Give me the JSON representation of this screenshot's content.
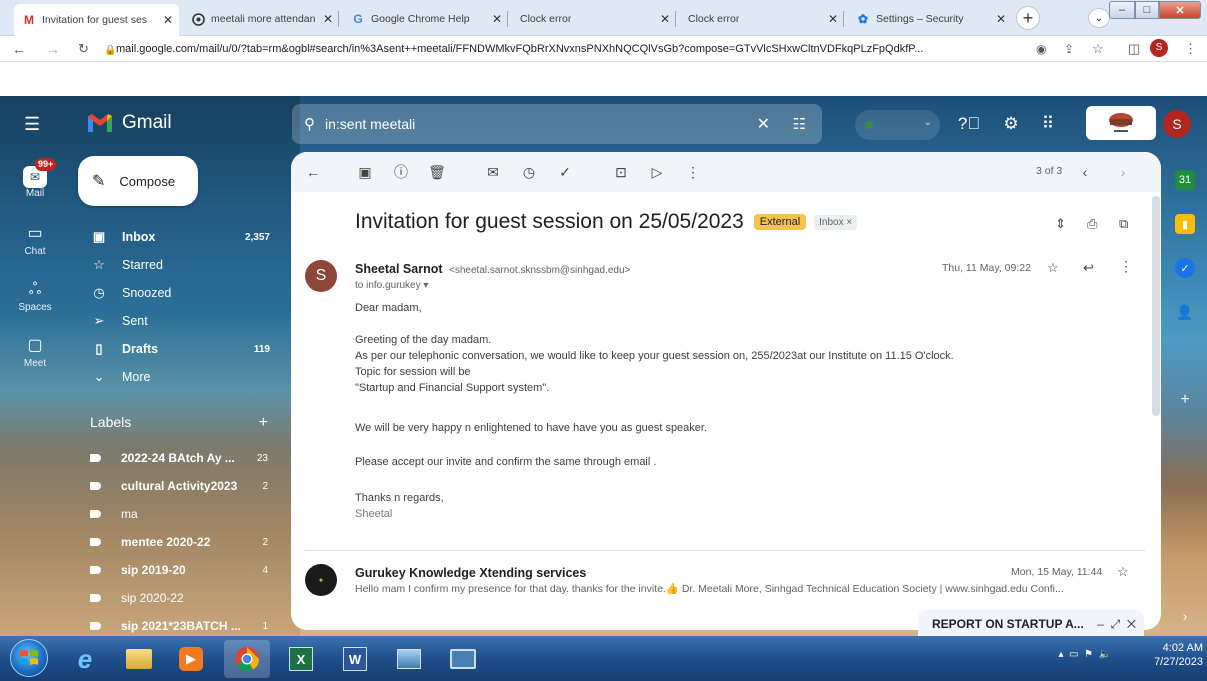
{
  "browser": {
    "tabs": [
      {
        "title": "Invitation for guest ses",
        "icon": "gmail-icon",
        "active": true
      },
      {
        "title": "meetali more attendan",
        "icon": "site-icon"
      },
      {
        "title": "Google Chrome Help",
        "icon": "google-icon"
      },
      {
        "title": "Clock error",
        "icon": ""
      },
      {
        "title": "Clock error",
        "icon": ""
      },
      {
        "title": "Settings – Security",
        "icon": "settings-icon"
      }
    ],
    "url": "mail.google.com/mail/u/0/?tab=rm&ogbl#search/in%3Asent++meetali/FFNDWMkvFQbRrXNvxnsPNXhNQCQlVsGb?compose=GTvVlcSHxwCltnVDFkqPLzFpQdkfP...",
    "profile_initial": "S"
  },
  "gmail": {
    "brand": "Gmail",
    "search_value": "in:sent meetali",
    "avatar_initial": "S",
    "rail": [
      {
        "label": "Mail",
        "badge": "99+"
      },
      {
        "label": "Chat"
      },
      {
        "label": "Spaces"
      },
      {
        "label": "Meet"
      }
    ],
    "compose_label": "Compose",
    "folders": [
      {
        "label": "Inbox",
        "count": "2,357",
        "bold": true
      },
      {
        "label": "Starred",
        "count": ""
      },
      {
        "label": "Snoozed",
        "count": ""
      },
      {
        "label": "Sent",
        "count": ""
      },
      {
        "label": "Drafts",
        "count": "119",
        "bold": true
      },
      {
        "label": "More",
        "count": ""
      }
    ],
    "labels_heading": "Labels",
    "labels": [
      {
        "label": "2022-24 BAtch Ay ...",
        "count": "23"
      },
      {
        "label": "cultural Activity2023",
        "count": "2"
      },
      {
        "label": "ma",
        "count": ""
      },
      {
        "label": "mentee 2020-22",
        "count": "2"
      },
      {
        "label": "sip 2019-20",
        "count": "4"
      },
      {
        "label": "sip 2020-22",
        "count": ""
      },
      {
        "label": "sip 2021*23BATCH ...",
        "count": "1"
      }
    ],
    "pagination": "3 of 3"
  },
  "email": {
    "subject": "Invitation for guest session on 25/05/2023",
    "badge_external": "External",
    "badge_inbox": "Inbox ×",
    "sender_name": "Sheetal Sarnot",
    "sender_email": "<sheetal.sarnot.sknssbm@sinhgad.edu>",
    "sender_initial": "S",
    "to": "to info.gurukey ▾",
    "date": "Thu, 11 May, 09:22",
    "body": [
      "Dear madam,",
      "Greeting of the day madam.",
      "As per our telephonic conversation, we would like to keep your guest session on, 255/2023at our Institute on 11.15 O'clock.",
      "Topic for session will be",
      "\"Startup and Financial Support system\".",
      "We will be very happy n enlightened to have have you as guest speaker.",
      "Please accept our invite and confirm the same through email .",
      "Thanks n regards,",
      "Sheetal"
    ],
    "reply": {
      "sender": "Gurukey Knowledge Xtending services",
      "snippet": "Hello mam I confirm my presence for that day. thanks for the invite.👍 Dr. Meetali More, Sinhgad Technical Education Society | www.sinhgad.edu Confi...",
      "date": "Mon, 15 May, 11:44"
    }
  },
  "draft_window": {
    "title": "REPORT ON STARTUP A..."
  },
  "taskbar": {
    "time": "4:02 AM",
    "date": "7/27/2023"
  },
  "colors": {
    "accent_external": "#f5c34c",
    "avatar_red": "#b3261e",
    "sender_avatar": "#8d4639"
  }
}
